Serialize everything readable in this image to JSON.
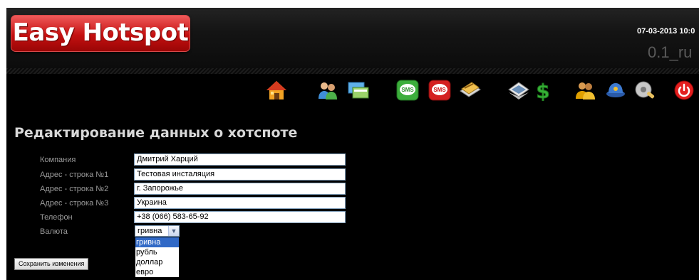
{
  "header": {
    "logo_text": "Easy Hotspot",
    "datetime": "07-03-2013 10:0",
    "version": "0.1_ru"
  },
  "toolbar": {
    "icons": [
      "home-icon",
      "users-icon",
      "cards-icon",
      "sms-green-icon",
      "sms-red-icon",
      "credit-card-icon",
      "vouchers-icon",
      "money-icon",
      "group-icon",
      "guard-icon",
      "settings-icon",
      "power-icon"
    ]
  },
  "page": {
    "title": "Редактирование данных о хотспоте"
  },
  "form": {
    "company_label": "Компания",
    "company_value": "Дмитрий Харций",
    "address1_label": "Адрес - строка №1",
    "address1_value": "Тестовая инсталяция",
    "address2_label": "Адрес - строка №2",
    "address2_value": "г. Запорожье",
    "address3_label": "Адрес - строка №3",
    "address3_value": "Украина",
    "phone_label": "Телефон",
    "phone_value": "+38 (066) 583-65-92",
    "currency_label": "Валюта",
    "currency_selected": "гривна",
    "currency_options": [
      "гривна",
      "рубль",
      "доллар",
      "евро"
    ],
    "save_label": "Сохранить изменения"
  },
  "colors": {
    "logo_red": "#c41010",
    "selection_blue": "#3169c6",
    "background": "#000000"
  }
}
